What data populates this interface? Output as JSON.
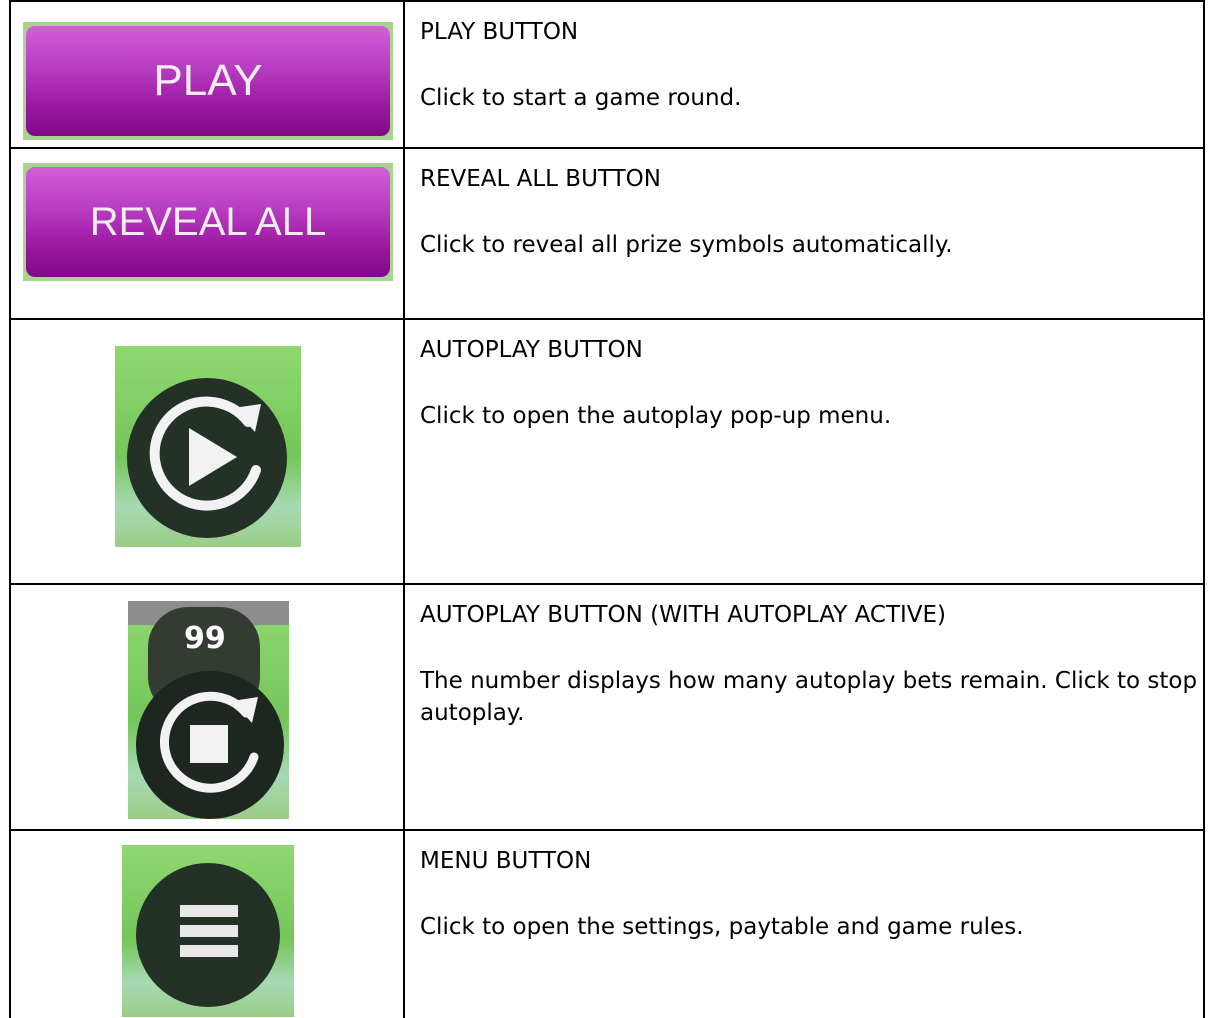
{
  "rows": [
    {
      "icon": "play-button",
      "button_text": "PLAY",
      "title": "PLAY BUTTON",
      "text": "Click to start a game round."
    },
    {
      "icon": "reveal-all-button",
      "button_text": "REVEAL ALL",
      "title": "REVEAL ALL BUTTON",
      "text": "Click to reveal all prize symbols automatically."
    },
    {
      "icon": "autoplay-icon",
      "title": "AUTOPLAY BUTTON",
      "text": "Click to open the autoplay pop-up menu."
    },
    {
      "icon": "autoplay-stop-icon",
      "badge": "99",
      "title": "AUTOPLAY BUTTON (WITH AUTOPLAY ACTIVE)",
      "text": "The number displays how many autoplay bets remain. Click to stop autoplay."
    },
    {
      "icon": "menu-icon",
      "title": "MENU BUTTON",
      "text": "Click to open the settings, paytable and game rules."
    }
  ],
  "colors": {
    "button_purple": "#b53bc0",
    "tile_green": "#74c65a",
    "icon_dark": "#243127"
  }
}
